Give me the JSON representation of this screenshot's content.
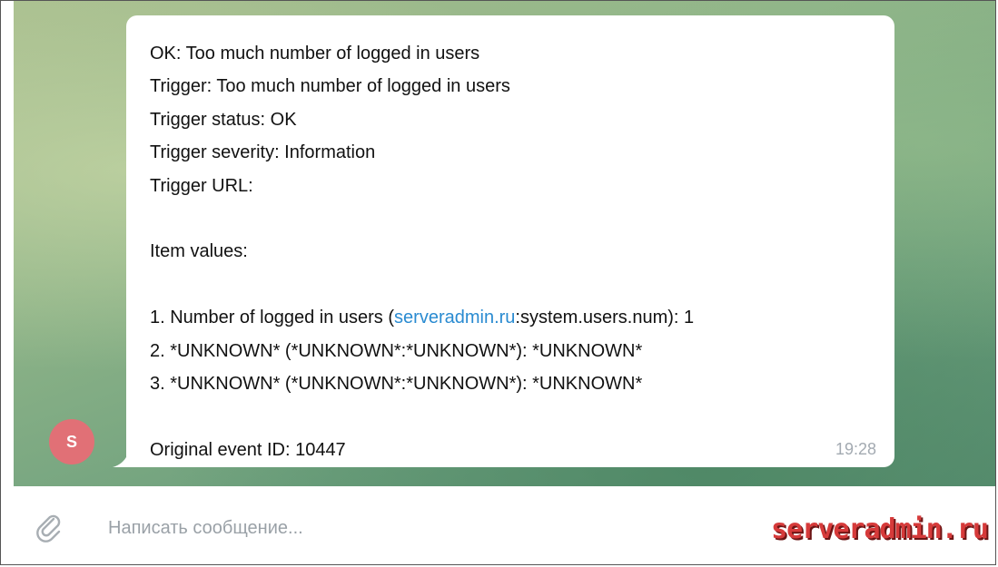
{
  "message": {
    "line1": "OK: Too much number of logged in users",
    "line2": "Trigger: Too much number of logged in users",
    "line3": "Trigger status: OK",
    "line4": "Trigger severity: Information",
    "line5": "Trigger URL:",
    "line6": "Item values:",
    "item1_prefix": "1. Number of logged in users (",
    "item1_link": "serveradmin.ru",
    "item1_suffix": ":system.users.num): 1",
    "item2": "2. *UNKNOWN* (*UNKNOWN*:*UNKNOWN*): *UNKNOWN*",
    "item3": "3. *UNKNOWN* (*UNKNOWN*:*UNKNOWN*): *UNKNOWN*",
    "event_id": "Original event ID: 10447",
    "time": "19:28"
  },
  "sender": {
    "avatar_letter": "S",
    "avatar_color": "#e17076"
  },
  "composer": {
    "attach_icon": "paperclip-icon",
    "placeholder": "Написать сообщение..."
  },
  "watermark": "serveradmin.ru",
  "colors": {
    "link": "#2a8bd1",
    "watermark": "#d63a3a"
  }
}
